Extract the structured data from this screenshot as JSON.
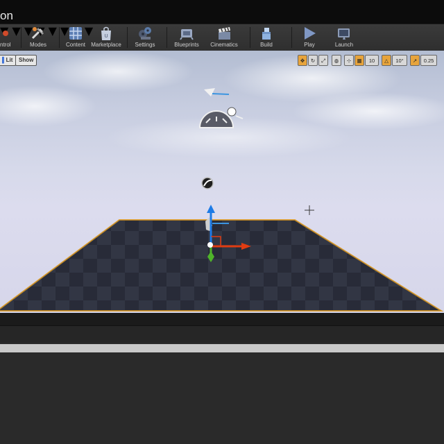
{
  "window": {
    "title_fragment": "on"
  },
  "toolbar": {
    "items": [
      {
        "label": "ntrol",
        "icon": "source-control-icon"
      },
      {
        "label": "Modes",
        "icon": "modes-tools-icon"
      },
      {
        "label": "Content",
        "icon": "content-grid-icon"
      },
      {
        "label": "Marketplace",
        "icon": "marketplace-bag-icon"
      },
      {
        "label": "Settings",
        "icon": "settings-gears-icon"
      },
      {
        "label": "Blueprints",
        "icon": "blueprints-icon"
      },
      {
        "label": "Cinematics",
        "icon": "clapperboard-icon"
      },
      {
        "label": "Build",
        "icon": "build-blocks-icon"
      },
      {
        "label": "Play",
        "icon": "play-icon"
      },
      {
        "label": "Launch",
        "icon": "launch-icon"
      }
    ]
  },
  "viewport": {
    "lit_label": "Lit",
    "show_label": "Show",
    "grid_snap_value": "10",
    "rotation_snap_value": "10°",
    "scale_snap_value": "0.25",
    "accent": "#e7a43c",
    "floor_outline": "#e0a030"
  }
}
